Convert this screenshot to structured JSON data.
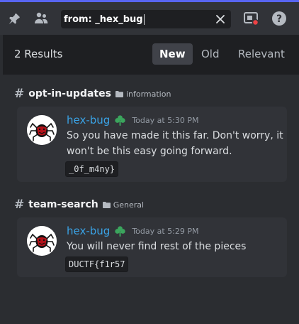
{
  "search": {
    "value": "from: _hex_bug"
  },
  "results": {
    "count_label": "2 Results",
    "sort_options": [
      "New",
      "Old",
      "Relevant"
    ],
    "active_sort": "New"
  },
  "groups": [
    {
      "channel": "opt-in-updates",
      "category": "information",
      "message": {
        "author": "hex-bug",
        "timestamp": "Today at 5:30 PM",
        "text_line1": "So you have made it this far. Don't worry, it",
        "text_line2": "won't be this easy going forward.",
        "code": "_0f_m4ny}"
      }
    },
    {
      "channel": "team-search",
      "category": "General",
      "message": {
        "author": "hex-bug",
        "timestamp": "Today at 5:29 PM",
        "text_line1": "You will never find rest of the pieces",
        "code": "DUCTF{f1r57"
      }
    }
  ],
  "colors": {
    "accent": "#5865f2",
    "author": "#3aa3e6",
    "badge": "#3ba55d",
    "notify": "#ed4245"
  }
}
